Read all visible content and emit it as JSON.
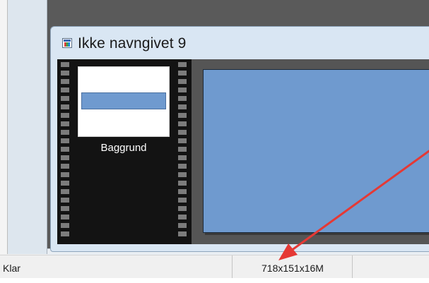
{
  "document": {
    "title": "Ikke navngivet 9",
    "icon": "image-document-icon",
    "layers": [
      {
        "label": "Baggrund"
      }
    ]
  },
  "statusbar": {
    "ready": "Klar",
    "size": "718x151x16M",
    "extra": ""
  },
  "colors": {
    "canvas": "#6f9acf",
    "workspace": "#5a5a5a",
    "filmstrip": "#131313",
    "annotation_arrow": "#e53935"
  }
}
